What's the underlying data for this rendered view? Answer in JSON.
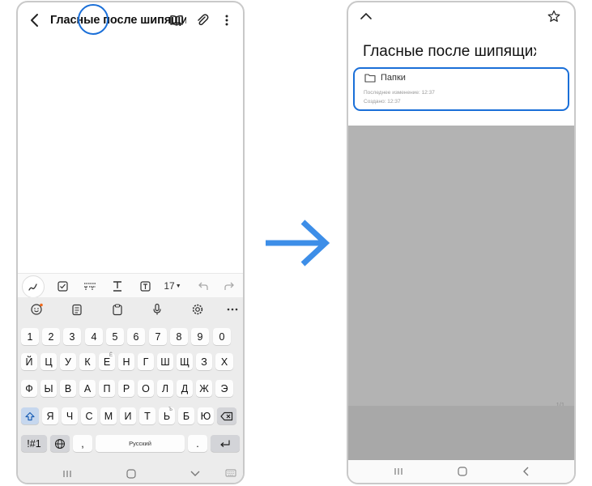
{
  "left_screen": {
    "title": "Гласные после шипящих",
    "toolbar": {
      "font_size": "17"
    },
    "keyboard": {
      "number_row": [
        "1",
        "2",
        "3",
        "4",
        "5",
        "6",
        "7",
        "8",
        "9",
        "0"
      ],
      "row1": [
        "Й",
        "Ц",
        "У",
        "К",
        "Е",
        "Н",
        "Г",
        "Ш",
        "Щ",
        "З",
        "Х"
      ],
      "row1_alt": "Ё",
      "row2": [
        "Ф",
        "Ы",
        "В",
        "А",
        "П",
        "Р",
        "О",
        "Л",
        "Д",
        "Ж",
        "Э"
      ],
      "row3": [
        "Я",
        "Ч",
        "С",
        "М",
        "И",
        "Т",
        "Ь",
        "Б",
        "Ю"
      ],
      "row3_alt": "Ъ",
      "symbols_key": "!#1",
      "comma_key": ",",
      "space_label": "Русский",
      "period_key": "."
    }
  },
  "right_screen": {
    "title": "Гласные после шипящих",
    "folder_label": "Папки",
    "modified": "Последнее изменение: 12:37",
    "created": "Создано: 12:37",
    "page_indicator": "1/1"
  },
  "colors": {
    "highlight": "#1a6fd8",
    "arrow": "#3d8ee8"
  },
  "icons": [
    "back-icon",
    "book-icon",
    "paperclip-icon",
    "more-vert-icon",
    "pen-icon",
    "checkbox-icon",
    "text-style-icon",
    "text-format-icon",
    "text-box-icon",
    "undo-icon",
    "redo-icon",
    "emoji-icon",
    "clipboard-icon",
    "keyboard-paste-icon",
    "mic-icon",
    "settings-icon",
    "more-horiz-icon",
    "shift-icon",
    "globe-icon",
    "backspace-icon",
    "enter-icon",
    "chevron-up-icon",
    "star-icon",
    "folder-icon",
    "recents-icon",
    "home-icon",
    "back-nav-icon",
    "keyboard-hide-icon"
  ]
}
